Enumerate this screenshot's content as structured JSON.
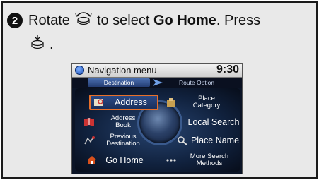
{
  "instruction": {
    "step_number": "2",
    "text_before": "Rotate",
    "text_middle": "to select",
    "target": "Go Home",
    "text_after": ". Press",
    "end": "."
  },
  "nav_screen": {
    "title": "Navigation menu",
    "clock": "9:30",
    "tabs": [
      "Destination",
      "Route Option"
    ],
    "items": {
      "address": "Address",
      "address_book": "Address\nBook",
      "previous_destination": "Previous\nDestination",
      "go_home": "Go Home",
      "place_category": "Place\nCategory",
      "local_search": "Local Search",
      "place_name": "Place Name",
      "more_search_methods": "More Search\nMethods"
    }
  },
  "colors": {
    "highlight": "#e8702a",
    "screen_bg": "#0b1426"
  },
  "icons": {
    "step": "number-badge-icon",
    "rotate": "interface-dial-rotate-icon",
    "press": "interface-dial-press-icon"
  }
}
